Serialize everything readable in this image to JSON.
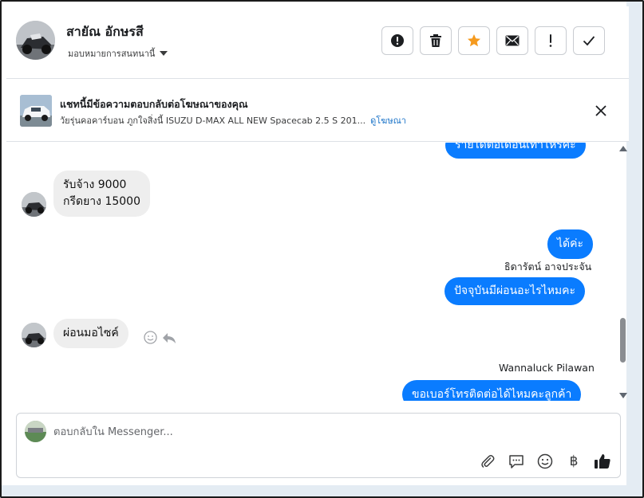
{
  "header": {
    "contact_name": "สายัณ อักษรสี",
    "assign_label": "มอบหมายการสนทนานี้",
    "actions": [
      {
        "name": "report-button",
        "icon": "exclamation-circle-icon"
      },
      {
        "name": "delete-button",
        "icon": "trash-icon"
      },
      {
        "name": "star-button",
        "icon": "star-icon",
        "color": "#f59a1e"
      },
      {
        "name": "mark-unread-button",
        "icon": "envelope-icon"
      },
      {
        "name": "follow-up-button",
        "icon": "exclamation-icon"
      },
      {
        "name": "mark-done-button",
        "icon": "checkmark-icon"
      }
    ]
  },
  "ad_banner": {
    "title": "แชทนี้มีข้อความตอบกลับต่อโฆษณาของคุณ",
    "subtitle": "วัยรุ่นคอคาร์บอน ภูกใจสิ่งนี้ ISUZU D-MAX ALL NEW Spacecab 2.5 S 201...",
    "link": "ดูโฆษณา"
  },
  "messages": {
    "partial_top": "รายได้ต่อเดือนเท่าไหร่คะ",
    "in_1_line_1": "รับจ้าง 9000",
    "in_1_line_2": "กรีดยาง 15000",
    "out_1": "ได้ค่ะ",
    "sender_1": "ธิดารัตน์ อาจประจัน",
    "out_2": "ปัจจุบันมีผ่อนอะไรไหมคะ",
    "in_2": "ผ่อนมอไซค์",
    "sender_2": "Wannaluck Pilawan",
    "out_3": "ขอเบอร์โทรติดต่อได้ไหมคะลูกค้า"
  },
  "composer": {
    "placeholder": "ตอบกลับใน Messenger...",
    "value": "",
    "tools": [
      "paperclip-icon",
      "speech-bubble-icon",
      "emoji-icon",
      "baht-icon",
      "thumbs-up-icon"
    ],
    "baht_symbol": "฿"
  },
  "colors": {
    "accent": "#0a7cff",
    "link": "#1a73c8",
    "star": "#f59a1e"
  }
}
